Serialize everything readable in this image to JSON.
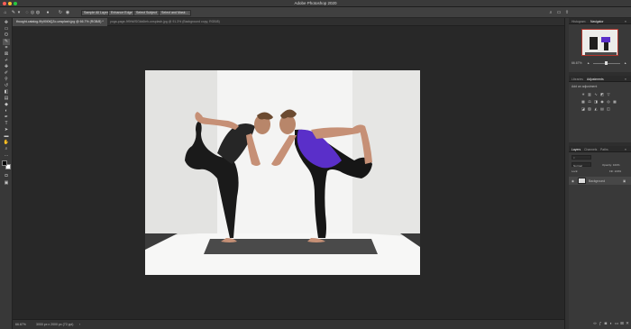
{
  "window": {
    "title": "Adobe Photoshop 2020"
  },
  "options_bar": {
    "sample_all_layers_label": "Sample All Layers",
    "enhance_edge_label": "Enhance Edge",
    "select_subject_label": "Select Subject",
    "select_and_mask_label": "Select and Mask..."
  },
  "document_tabs": [
    {
      "label": "thought-catalog-9fy90i0tQZo-unsplash.jpg @ 66.7% (RGB/8) *"
    },
    {
      "label": "yoga-page-9f9hWSGkk6ieh-unsplash.jpg @ 91.3% (Background copy, RGB/8)"
    }
  ],
  "status": {
    "zoom": "66.67%",
    "doc_info": "3000 px x 2000 px (72 ppi)"
  },
  "navigator": {
    "tabs": [
      {
        "label": "Histogram"
      },
      {
        "label": "Navigator"
      }
    ],
    "zoom": "66.67%"
  },
  "adjustments": {
    "tabs": [
      {
        "label": "Libraries"
      },
      {
        "label": "Adjustments"
      }
    ],
    "heading": "Add an adjustment"
  },
  "layers": {
    "tabs": [
      {
        "label": "Layers"
      },
      {
        "label": "Channels"
      },
      {
        "label": "Paths"
      }
    ],
    "blend_mode": "Normal",
    "opacity_label": "Opacity: 100%",
    "lock_label": "Lock:",
    "fill_label": "Fill: 100%",
    "items": [
      {
        "name": "Background"
      }
    ]
  },
  "colors": {
    "foreground": "#000000",
    "background": "#ffffff",
    "violet_top": "#5a2fc9"
  }
}
